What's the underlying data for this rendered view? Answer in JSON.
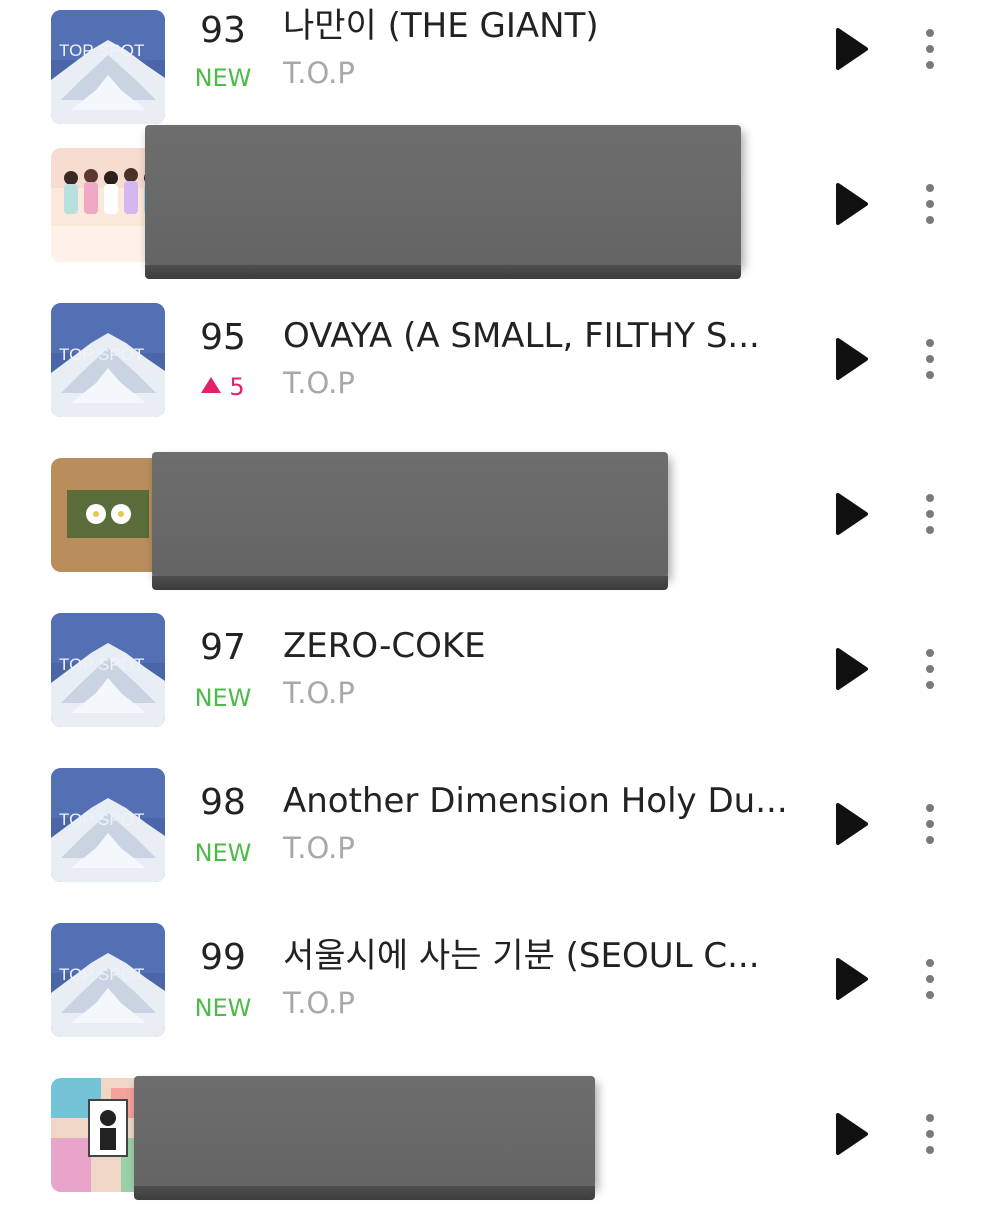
{
  "colors": {
    "new_badge": "#4cbb48",
    "rank_up": "#e2226a",
    "title_text": "#222222",
    "artist_text": "#a8a8a8",
    "redaction": "#666666"
  },
  "icons": {
    "play": "play-icon",
    "more": "more-vertical-icon"
  },
  "rows": [
    {
      "rank": "93",
      "change": "NEW",
      "change_type": "new",
      "title": "나만이 (THE GIANT)",
      "artist": "T.O.P",
      "art": "top-spot",
      "art_text": "TOP SPOT"
    },
    {
      "rank": "",
      "change": "",
      "change_type": "",
      "title": "",
      "artist": "",
      "art": "group-photo",
      "redacted": true
    },
    {
      "rank": "95",
      "change": "5",
      "change_type": "up",
      "title": "OVAYA (A SMALL, FILTHY S...",
      "artist": "T.O.P",
      "art": "top-spot",
      "art_text": "TOP SPOT"
    },
    {
      "rank": "",
      "change": "",
      "change_type": "",
      "title": "",
      "artist": "",
      "art": "flowers",
      "redacted": true
    },
    {
      "rank": "97",
      "change": "NEW",
      "change_type": "new",
      "title": "ZERO-COKE",
      "artist": "T.O.P",
      "art": "top-spot",
      "art_text": "TOP SPOT"
    },
    {
      "rank": "98",
      "change": "NEW",
      "change_type": "new",
      "title": "Another Dimension Holy Du...",
      "artist": "T.O.P",
      "art": "top-spot",
      "art_text": "TOP SPOT"
    },
    {
      "rank": "99",
      "change": "NEW",
      "change_type": "new",
      "title": "서울시에 사는 기분 (SEOUL C...",
      "artist": "T.O.P",
      "art": "top-spot",
      "art_text": "TOP SPOT"
    },
    {
      "rank": "",
      "change": "",
      "change_type": "",
      "title": "",
      "artist": "",
      "art": "collage",
      "redacted": true
    }
  ]
}
